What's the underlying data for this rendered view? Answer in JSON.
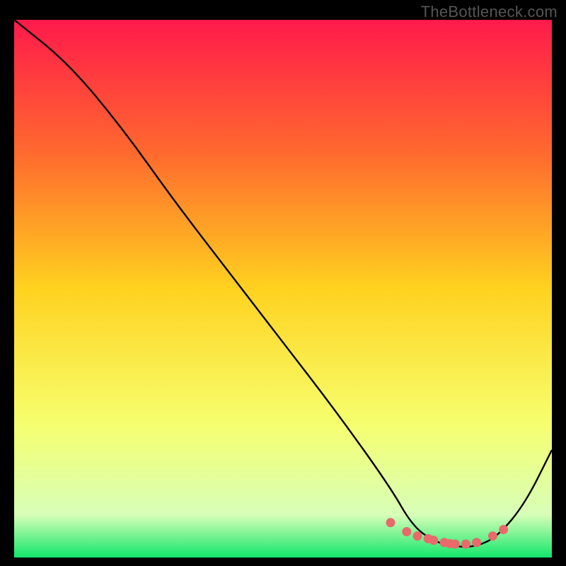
{
  "watermark": "TheBottleneck.com",
  "colors": {
    "bg_black": "#000000",
    "watermark_gray": "#555555",
    "line_black": "#000000",
    "marker_coral": "#e86a6a",
    "grad_top": "#ff1a4b",
    "grad_upper_mid": "#ff6a2e",
    "grad_mid": "#ffd21f",
    "grad_lower_mid": "#f6ff6e",
    "grad_pale": "#d8ffb8",
    "grad_green": "#12e66b"
  },
  "chart_data": {
    "type": "line",
    "title": "",
    "xlabel": "",
    "ylabel": "",
    "xlim": [
      0,
      100
    ],
    "ylim": [
      0,
      100
    ],
    "series": [
      {
        "name": "curve",
        "x": [
          0,
          10,
          20,
          30,
          40,
          50,
          60,
          70,
          74,
          78,
          82,
          86,
          90,
          95,
          100
        ],
        "y": [
          100,
          92,
          80,
          66,
          53,
          40,
          27,
          13,
          6,
          3,
          2,
          2,
          4,
          10,
          20
        ]
      }
    ],
    "markers": {
      "name": "valley-markers",
      "x": [
        70,
        73,
        75,
        77,
        78,
        80,
        81,
        82,
        84,
        86,
        89,
        91
      ],
      "y": [
        6.5,
        4.8,
        4.0,
        3.5,
        3.2,
        2.8,
        2.6,
        2.5,
        2.5,
        2.8,
        4.0,
        5.2
      ]
    },
    "background_gradient_stops": [
      {
        "offset": 0.0,
        "color": "#ff1a4b"
      },
      {
        "offset": 0.25,
        "color": "#ff6a2e"
      },
      {
        "offset": 0.5,
        "color": "#ffd21f"
      },
      {
        "offset": 0.75,
        "color": "#f6ff6e"
      },
      {
        "offset": 0.92,
        "color": "#d8ffb8"
      },
      {
        "offset": 1.0,
        "color": "#12e66b"
      }
    ]
  }
}
